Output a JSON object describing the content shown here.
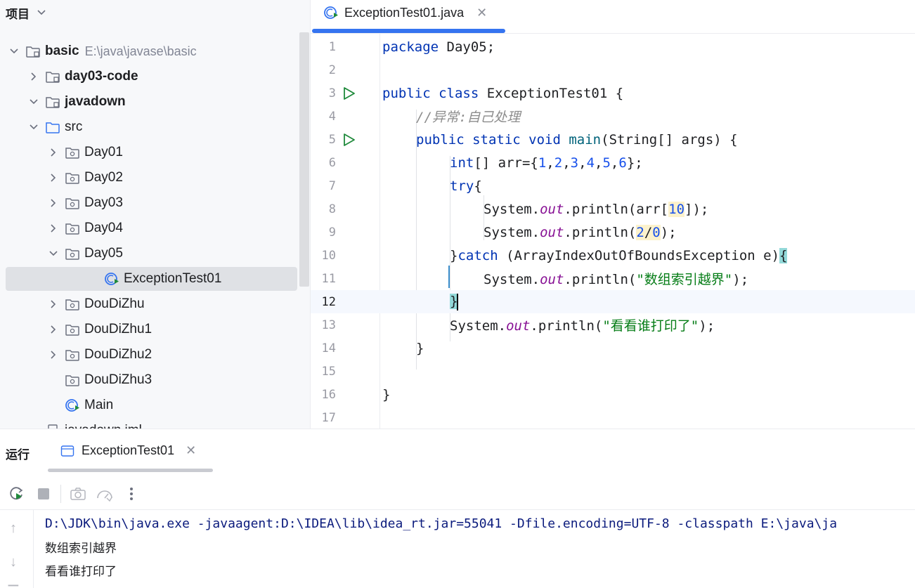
{
  "project_panel": {
    "title": "项目",
    "tree": [
      {
        "label": "basic",
        "path": "E:\\java\\javase\\basic",
        "indent": 0,
        "expanded": true,
        "bold": true,
        "icon": "module-folder-icon"
      },
      {
        "label": "day03-code",
        "indent": 1,
        "expanded": false,
        "bold": true,
        "icon": "module-folder-icon"
      },
      {
        "label": "javadown",
        "indent": 1,
        "expanded": true,
        "bold": true,
        "icon": "module-folder-icon"
      },
      {
        "label": "src",
        "indent": 2,
        "expanded": true,
        "icon": "source-folder-icon"
      },
      {
        "label": "Day01",
        "indent": 3,
        "expanded": false,
        "icon": "package-icon"
      },
      {
        "label": "Day02",
        "indent": 3,
        "expanded": false,
        "icon": "package-icon"
      },
      {
        "label": "Day03",
        "indent": 3,
        "expanded": false,
        "icon": "package-icon"
      },
      {
        "label": "Day04",
        "indent": 3,
        "expanded": false,
        "icon": "package-icon"
      },
      {
        "label": "Day05",
        "indent": 3,
        "expanded": true,
        "icon": "package-icon"
      },
      {
        "label": "ExceptionTest01",
        "indent": 4,
        "selected": true,
        "icon": "runnable-class-icon"
      },
      {
        "label": "DouDiZhu",
        "indent": 3,
        "expanded": false,
        "icon": "package-icon"
      },
      {
        "label": "DouDiZhu1",
        "indent": 3,
        "expanded": false,
        "icon": "package-icon"
      },
      {
        "label": "DouDiZhu2",
        "indent": 3,
        "expanded": false,
        "icon": "package-icon"
      },
      {
        "label": "DouDiZhu3",
        "indent": 3,
        "icon": "package-icon"
      },
      {
        "label": "Main",
        "indent": 3,
        "icon": "runnable-class-icon"
      },
      {
        "label": "javadown.iml",
        "indent": 2,
        "icon": "file-icon"
      }
    ]
  },
  "editor": {
    "tab_label": "ExceptionTest01.java",
    "current_line": 12,
    "lines": [
      "1",
      "2",
      "3",
      "4",
      "5",
      "6",
      "7",
      "8",
      "9",
      "10",
      "11",
      "12",
      "13",
      "14",
      "15",
      "16",
      "17"
    ],
    "code": {
      "l1_kw": "package",
      "l1_rest": " Day05;",
      "l3_kw": "public class",
      "l3_rest": " ExceptionTest01 {",
      "l4_comment": "//异常:自己处理",
      "l5_kw": "public static void",
      "l5_fn": "main",
      "l5_rest": "(String[] args) {",
      "l6_kw": "int",
      "l6_a": "[] arr={",
      "l6_n1": "1",
      "l6_n2": "2",
      "l6_n3": "3",
      "l6_n4": "4",
      "l6_n5": "5",
      "l6_n6": "6",
      "l6_comma": ",",
      "l6_end": "};",
      "l7_kw": "try",
      "l7_rest": "{",
      "system": "System.",
      "out": "out",
      "println": ".println(",
      "l8_a": "arr[",
      "l8_n": "10",
      "l8_end": "]);",
      "l9_n1": "2",
      "l9_div": "/",
      "l9_n2": "0",
      "l9_end": ");",
      "l10_a": "}",
      "l10_kw": "catch",
      "l10_rest": " (ArrayIndexOutOfBoundsException e)",
      "l10_brace": "{",
      "l11_str": "\"数组索引越界\"",
      "l11_end": ");",
      "l12_brace": "}",
      "l13_str": "\"看看谁打印了\"",
      "l13_end": ");",
      "l14": "}",
      "l16": "}"
    }
  },
  "run_panel": {
    "title": "运行",
    "tab_label": "ExceptionTest01",
    "console": [
      "D:\\JDK\\bin\\java.exe -javaagent:D:\\IDEA\\lib\\idea_rt.jar=55041 -Dfile.encoding=UTF-8 -classpath E:\\java\\ja",
      "数组索引越界",
      "看看谁打印了"
    ],
    "toolbar": [
      "rerun-icon",
      "stop-icon",
      "camera-icon",
      "profiler-icon",
      "more-icon"
    ]
  },
  "colors": {
    "accent": "#3574f0",
    "keyword": "#0033b3",
    "string": "#067d17",
    "number": "#1750eb",
    "run_green": "#208a3c"
  }
}
